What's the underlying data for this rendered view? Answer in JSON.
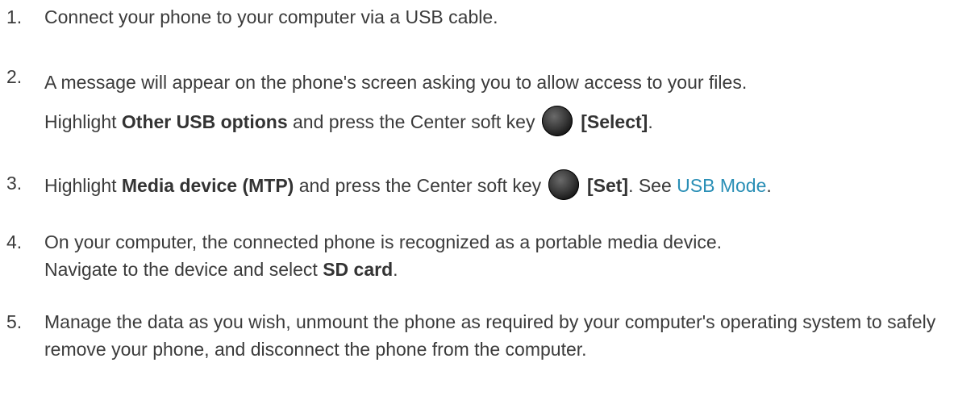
{
  "steps": [
    {
      "number": "1.",
      "text": "Connect your phone to your computer via a USB cable."
    },
    {
      "number": "2.",
      "line1": "A message will appear on the phone's screen asking you to allow access to your files.",
      "highlight_prefix": "Highlight ",
      "option_bold": "Other USB options",
      "mid": " and press the Center soft key ",
      "key_label": "[Select]",
      "end": "."
    },
    {
      "number": "3.",
      "highlight_prefix": "Highlight ",
      "option_bold": "Media device (MTP)",
      "mid": " and press the Center soft key ",
      "key_label": "[Set]",
      "after": ". See ",
      "link": "USB Mode",
      "end": "."
    },
    {
      "number": "4.",
      "line1": "On your computer, the connected phone is recognized as a portable media device.",
      "line2_prefix": "Navigate to the device and select ",
      "bold": "SD card",
      "end": "."
    },
    {
      "number": "5.",
      "text": "Manage the data as you wish, unmount the phone as required by your computer's operating system to safely remove your phone, and disconnect the phone from the computer."
    }
  ],
  "icons": {
    "center_key": "center-soft-key-icon"
  },
  "colors": {
    "text": "#3b3b3b",
    "link": "#2a8fb6",
    "key": "#222222"
  }
}
